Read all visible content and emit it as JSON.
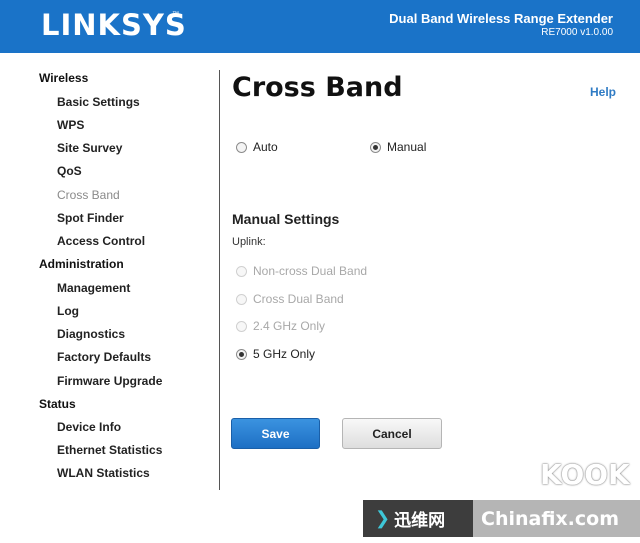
{
  "header": {
    "logo": "LINKSYS",
    "logo_tm": "™",
    "product_name": "Dual Band Wireless Range Extender",
    "model": "RE7000 v1.0.00"
  },
  "sidebar": {
    "sections": [
      {
        "label": "Wireless",
        "items": [
          "Basic Settings",
          "WPS",
          "Site Survey",
          "QoS",
          "Cross Band",
          "Spot Finder",
          "Access Control"
        ]
      },
      {
        "label": "Administration",
        "items": [
          "Management",
          "Log",
          "Diagnostics",
          "Factory Defaults",
          "Firmware Upgrade"
        ]
      },
      {
        "label": "Status",
        "items": [
          "Device Info",
          "Ethernet Statistics",
          "WLAN Statistics"
        ]
      }
    ],
    "active_item": "Cross Band"
  },
  "main": {
    "title": "Cross Band",
    "help": "Help",
    "mode_options": [
      {
        "label": "Auto",
        "checked": false
      },
      {
        "label": "Manual",
        "checked": true
      }
    ],
    "manual_heading": "Manual Settings",
    "uplink_label": "Uplink:",
    "uplink_options": [
      {
        "label": "Non-cross Dual Band",
        "checked": false,
        "disabled": true
      },
      {
        "label": "Cross Dual Band",
        "checked": false,
        "disabled": true
      },
      {
        "label": "2.4 GHz Only",
        "checked": false,
        "disabled": true
      },
      {
        "label": "5 GHz Only",
        "checked": true,
        "disabled": false
      }
    ],
    "save": "Save",
    "cancel": "Cancel"
  },
  "watermark": {
    "arrow": "❯",
    "cn_text": "迅维网",
    "site_text": "Chinafix.com",
    "kook": "KOOK"
  },
  "colors": {
    "header_bg": "#1a73c8",
    "save_button": "#1d6fc4",
    "help_link": "#2f7bc4"
  }
}
